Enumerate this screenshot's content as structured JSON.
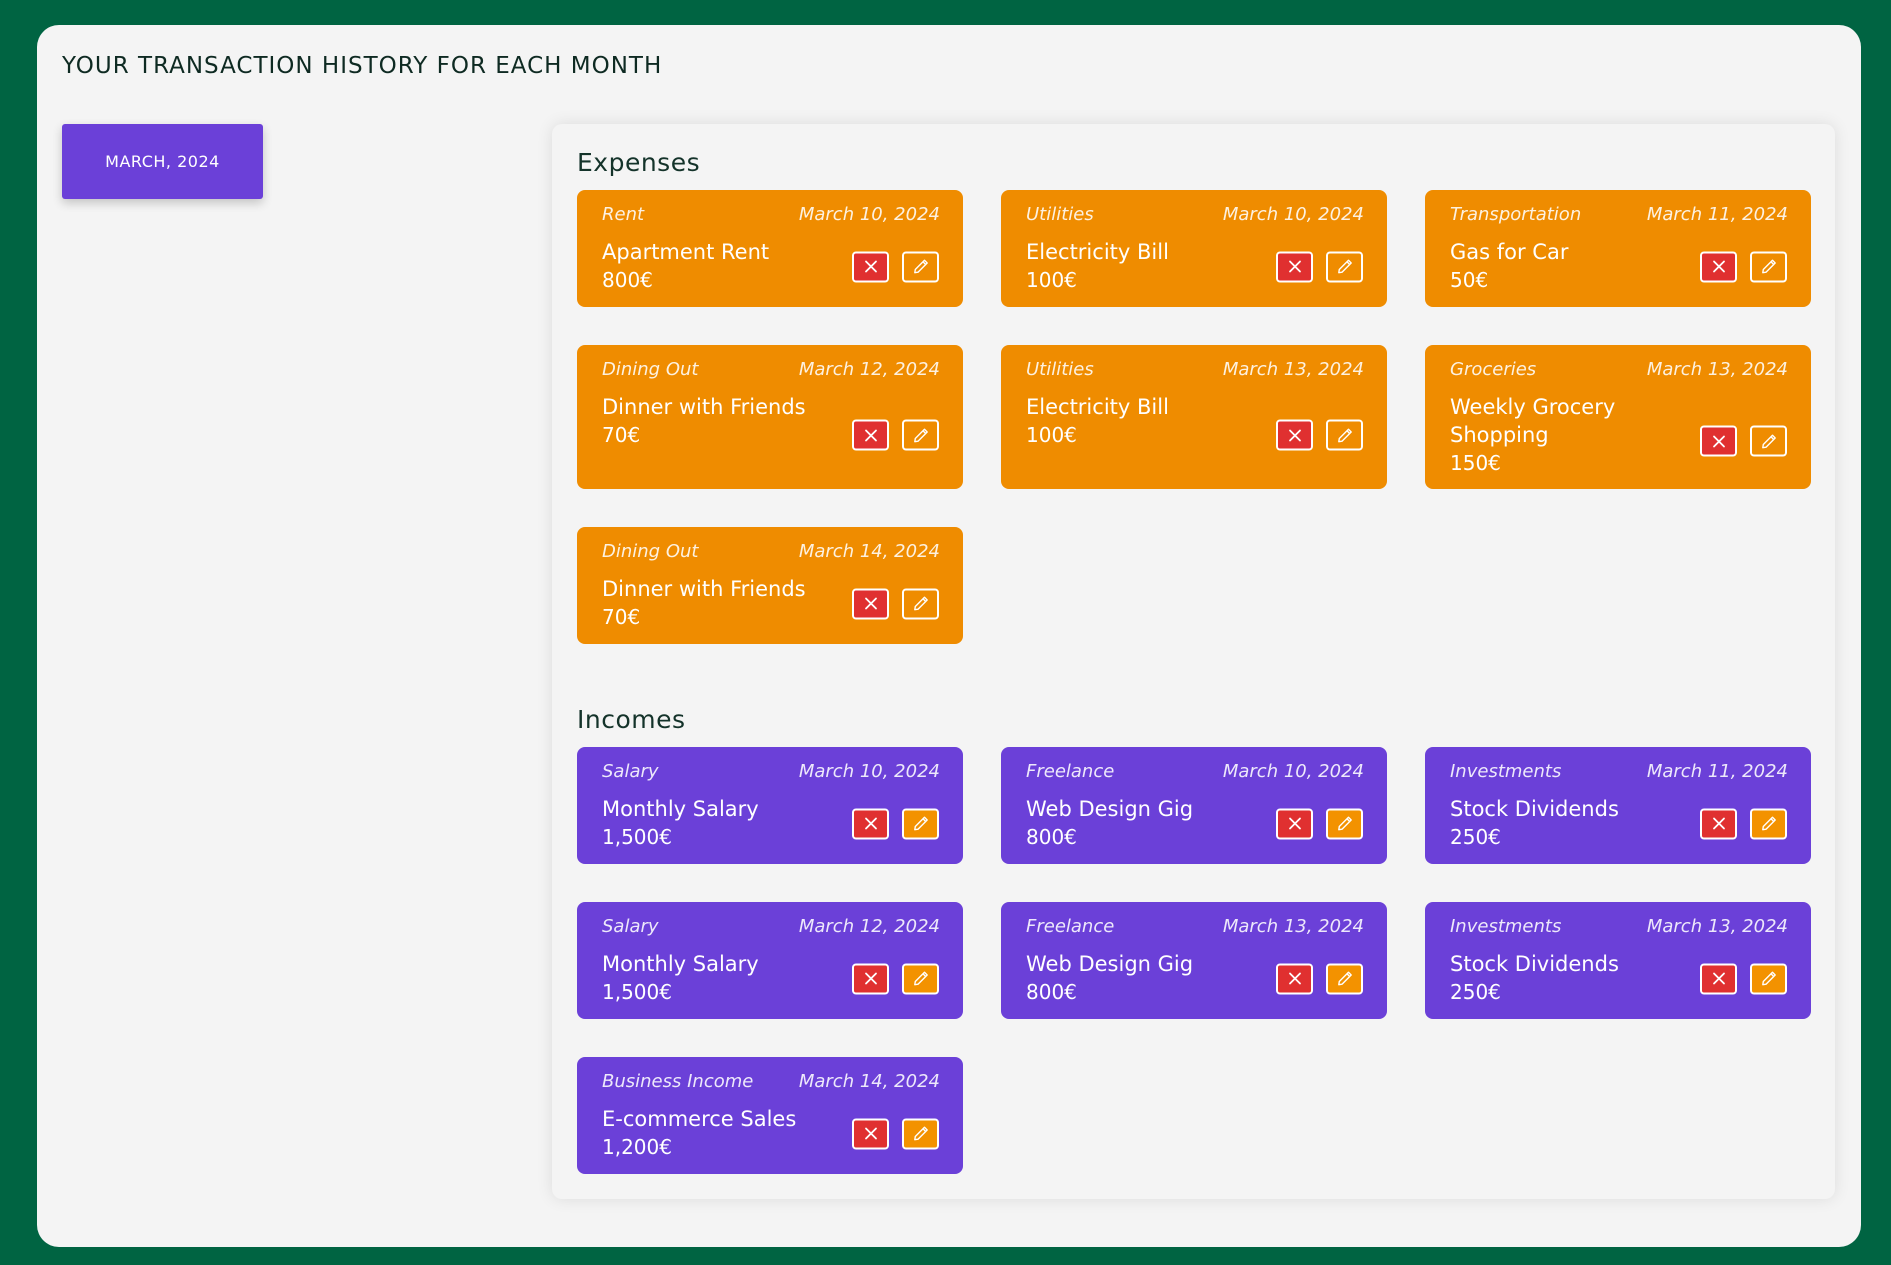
{
  "page": {
    "title": "YOUR TRANSACTION HISTORY FOR EACH MONTH",
    "month_button": "MARCH, 2024"
  },
  "expenses": {
    "title": "Expenses",
    "items": [
      {
        "category": "Rent",
        "date": "March 10, 2024",
        "name": "Apartment Rent",
        "amount": "800€"
      },
      {
        "category": "Utilities",
        "date": "March 10, 2024",
        "name": "Electricity Bill",
        "amount": "100€"
      },
      {
        "category": "Transportation",
        "date": "March 11, 2024",
        "name": "Gas for Car",
        "amount": "50€"
      },
      {
        "category": "Dining Out",
        "date": "March 12, 2024",
        "name": "Dinner with Friends",
        "amount": "70€"
      },
      {
        "category": "Utilities",
        "date": "March 13, 2024",
        "name": "Electricity Bill",
        "amount": "100€"
      },
      {
        "category": "Groceries",
        "date": "March 13, 2024",
        "name": "Weekly Grocery Shopping",
        "amount": "150€"
      },
      {
        "category": "Dining Out",
        "date": "March 14, 2024",
        "name": "Dinner with Friends",
        "amount": "70€"
      }
    ]
  },
  "incomes": {
    "title": "Incomes",
    "items": [
      {
        "category": "Salary",
        "date": "March 10, 2024",
        "name": "Monthly Salary",
        "amount": "1,500€"
      },
      {
        "category": "Freelance",
        "date": "March 10, 2024",
        "name": "Web Design Gig",
        "amount": "800€"
      },
      {
        "category": "Investments",
        "date": "March 11, 2024",
        "name": "Stock Dividends",
        "amount": "250€"
      },
      {
        "category": "Salary",
        "date": "March 12, 2024",
        "name": "Monthly Salary",
        "amount": "1,500€"
      },
      {
        "category": "Freelance",
        "date": "March 13, 2024",
        "name": "Web Design Gig",
        "amount": "800€"
      },
      {
        "category": "Investments",
        "date": "March 13, 2024",
        "name": "Stock Dividends",
        "amount": "250€"
      },
      {
        "category": "Business Income",
        "date": "March 14, 2024",
        "name": "E-commerce Sales",
        "amount": "1,200€"
      }
    ]
  },
  "colors": {
    "background": "#006442",
    "expense_card": "#ef8c00",
    "income_card": "#6b40d8",
    "delete_button": "#e03030",
    "edit_button_income": "#f39200"
  },
  "icons": {
    "delete": "close-icon",
    "edit": "pencil-icon"
  }
}
